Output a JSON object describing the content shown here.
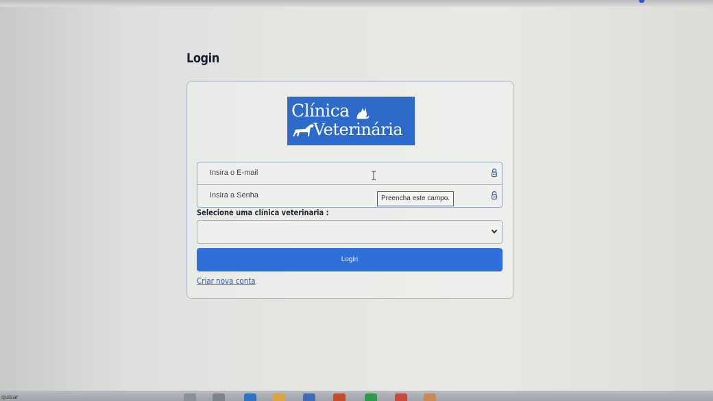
{
  "page": {
    "title": "Login"
  },
  "logo": {
    "line1": "Clínica",
    "line2": "Veterinária"
  },
  "form": {
    "email_placeholder": "Insira o E-mail",
    "password_placeholder": "Insira a Senha",
    "tooltip": "Preencha este campo.",
    "select_label": "Selecione uma clínica veterinaria :",
    "select_value": "",
    "login_label": "Login",
    "create_account_label": "Criar nova conta"
  },
  "taskbar": {
    "search_text": "quisar"
  },
  "colors": {
    "brand_blue": "#2d6ac9",
    "button_blue": "#2e6fdc",
    "link_blue": "#2f5fbf"
  }
}
